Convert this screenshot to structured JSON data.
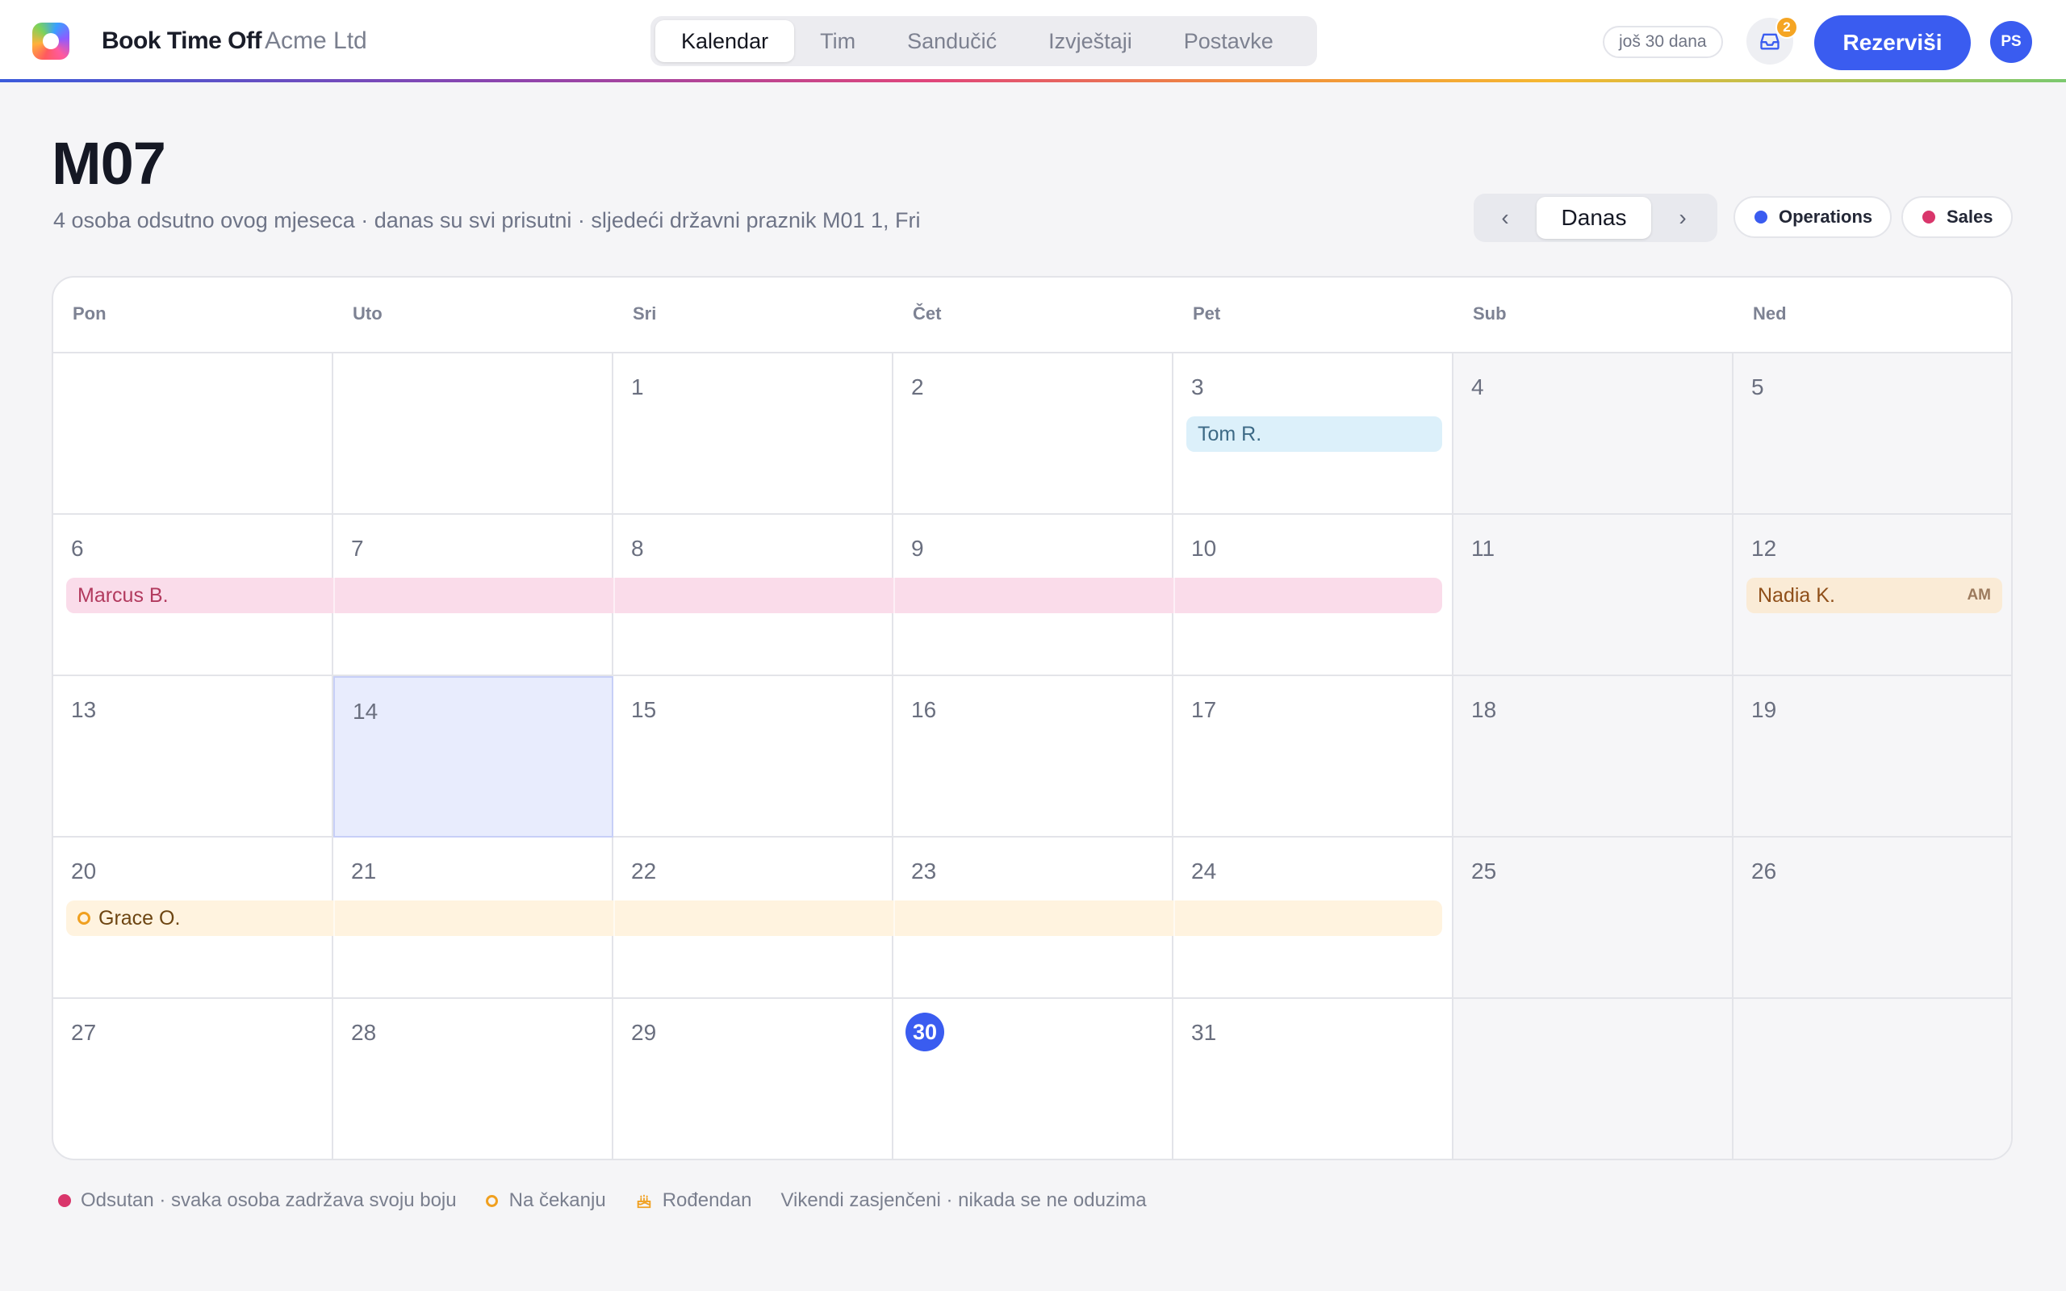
{
  "app": {
    "brand": "Book Time Off",
    "company": "Acme Ltd",
    "nav": [
      "Kalendar",
      "Tim",
      "Sandučić",
      "Izvještaji",
      "Postavke"
    ],
    "active_nav": "Kalendar",
    "trial": "još 30 dana",
    "inbox_count": "2",
    "book_label": "Rezerviši",
    "avatar_initials": "PS"
  },
  "header": {
    "title": "M07",
    "subtitle": "4 osoba odsutno ovog mjeseca · danas su svi prisutni · sljedeći državni praznik M01 1, Fri",
    "prev_icon": "‹",
    "today_label": "Danas",
    "next_icon": "›",
    "filters": [
      {
        "label": "Operations",
        "color": "#3a5cf0"
      },
      {
        "label": "Sales",
        "color": "#d9366b"
      }
    ]
  },
  "calendar": {
    "weekdays": [
      "Pon",
      "Uto",
      "Sri",
      "Čet",
      "Pet",
      "Sub",
      "Ned"
    ],
    "weeks": [
      [
        "",
        "",
        "1",
        "2",
        "3",
        "4",
        "5"
      ],
      [
        "6",
        "7",
        "8",
        "9",
        "10",
        "11",
        "12"
      ],
      [
        "13",
        "14",
        "15",
        "16",
        "17",
        "18",
        "19"
      ],
      [
        "20",
        "21",
        "22",
        "23",
        "24",
        "25",
        "26"
      ],
      [
        "27",
        "28",
        "29",
        "30",
        "31",
        "",
        ""
      ]
    ],
    "today": "30",
    "selected": "14",
    "events": [
      {
        "name": "Tom R.",
        "start": "3",
        "end": "3",
        "status": "approved",
        "color": "#dcf0fa"
      },
      {
        "name": "Marcus B.",
        "start": "6",
        "end": "10",
        "status": "approved",
        "color": "#fadcea"
      },
      {
        "name": "Nadia K.",
        "start": "12",
        "end": "12",
        "status": "approved",
        "tag": "AM",
        "color": "#faebd6"
      },
      {
        "name": "Grace O.",
        "start": "20",
        "end": "24",
        "status": "pending",
        "color": "#fff3df"
      }
    ]
  },
  "legend": {
    "absent": "Odsutan · svaka osoba zadržava svoju boju",
    "pending": "Na čekanju",
    "birthday": "Rođendan",
    "weekends": "Vikendi zasjenčeni · nikada se ne oduzima"
  }
}
